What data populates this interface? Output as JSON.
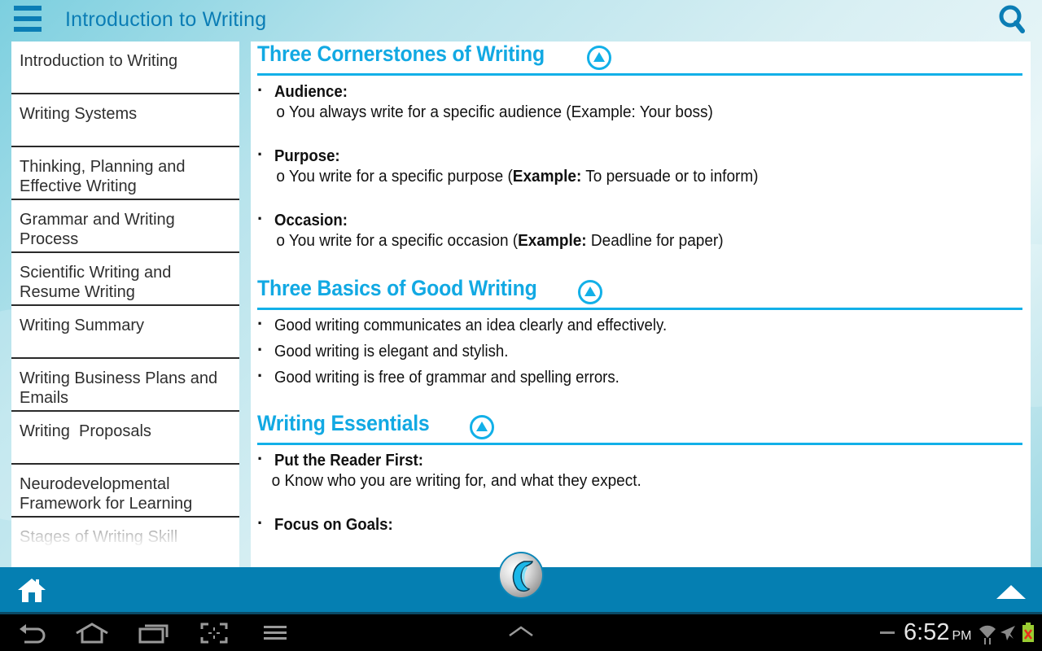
{
  "header": {
    "title": "Introduction to Writing",
    "menu_icon": "hamburger-menu-icon",
    "search_icon": "search-icon"
  },
  "sidebar": {
    "items": [
      {
        "label": "Introduction to Writing"
      },
      {
        "label": "Writing Systems"
      },
      {
        "label": "Thinking, Planning and Effective Writing"
      },
      {
        "label": "Grammar and Writing Process"
      },
      {
        "label": "Scientific Writing and Resume Writing"
      },
      {
        "label": "Writing Summary"
      },
      {
        "label": "Writing Business Plans and Emails"
      },
      {
        "label": "Writing  Proposals"
      },
      {
        "label": "Neurodevelopmental Framework for Learning"
      },
      {
        "label": "Stages of Writing Skill"
      }
    ]
  },
  "content": {
    "sections": [
      {
        "title": "Three Cornerstones of Writing",
        "bullets": [
          {
            "heading": "Audience:",
            "sub_marker": "o",
            "sub_text": "You always write for a specific audience (Example: Your boss)"
          },
          {
            "heading": "Purpose:",
            "sub_marker": "o",
            "sub_prefix": "You write for a specific purpose (",
            "sub_bold": "Example:",
            "sub_suffix": " To persuade or to inform)"
          },
          {
            "heading": "Occasion:",
            "sub_marker": "o",
            "sub_prefix": "You write for a specific occasion (",
            "sub_bold": "Example:",
            "sub_suffix": " Deadline for paper)"
          }
        ]
      },
      {
        "title": "Three Basics of Good Writing",
        "bullets": [
          {
            "text": "Good writing communicates an idea clearly and effectively."
          },
          {
            "text": "Good writing is elegant and stylish."
          },
          {
            "text": "Good writing is free of grammar and spelling errors."
          }
        ]
      },
      {
        "title": "Writing Essentials",
        "bullets": [
          {
            "heading": "Put the Reader First:",
            "sub_marker": "o",
            "sub_text": "Know who you are writing for, and what they expect."
          },
          {
            "heading": "Focus on Goals:"
          }
        ]
      }
    ]
  },
  "bottom_bar": {
    "home_icon": "home-icon",
    "logo_icon": "app-logo-icon",
    "scroll_top_icon": "scroll-to-top-icon"
  },
  "system_bar": {
    "time": "6:52",
    "ampm": "PM",
    "icons": [
      "back-icon",
      "home-icon",
      "recent-apps-icon",
      "screenshot-icon",
      "menu-icon",
      "notifications-up-icon",
      "wifi-icon",
      "airplane-mode-icon",
      "battery-icon"
    ]
  },
  "colors": {
    "accent": "#12b0e8",
    "brand_dark": "#0b7db5",
    "bottom_bar": "#057fb2"
  }
}
